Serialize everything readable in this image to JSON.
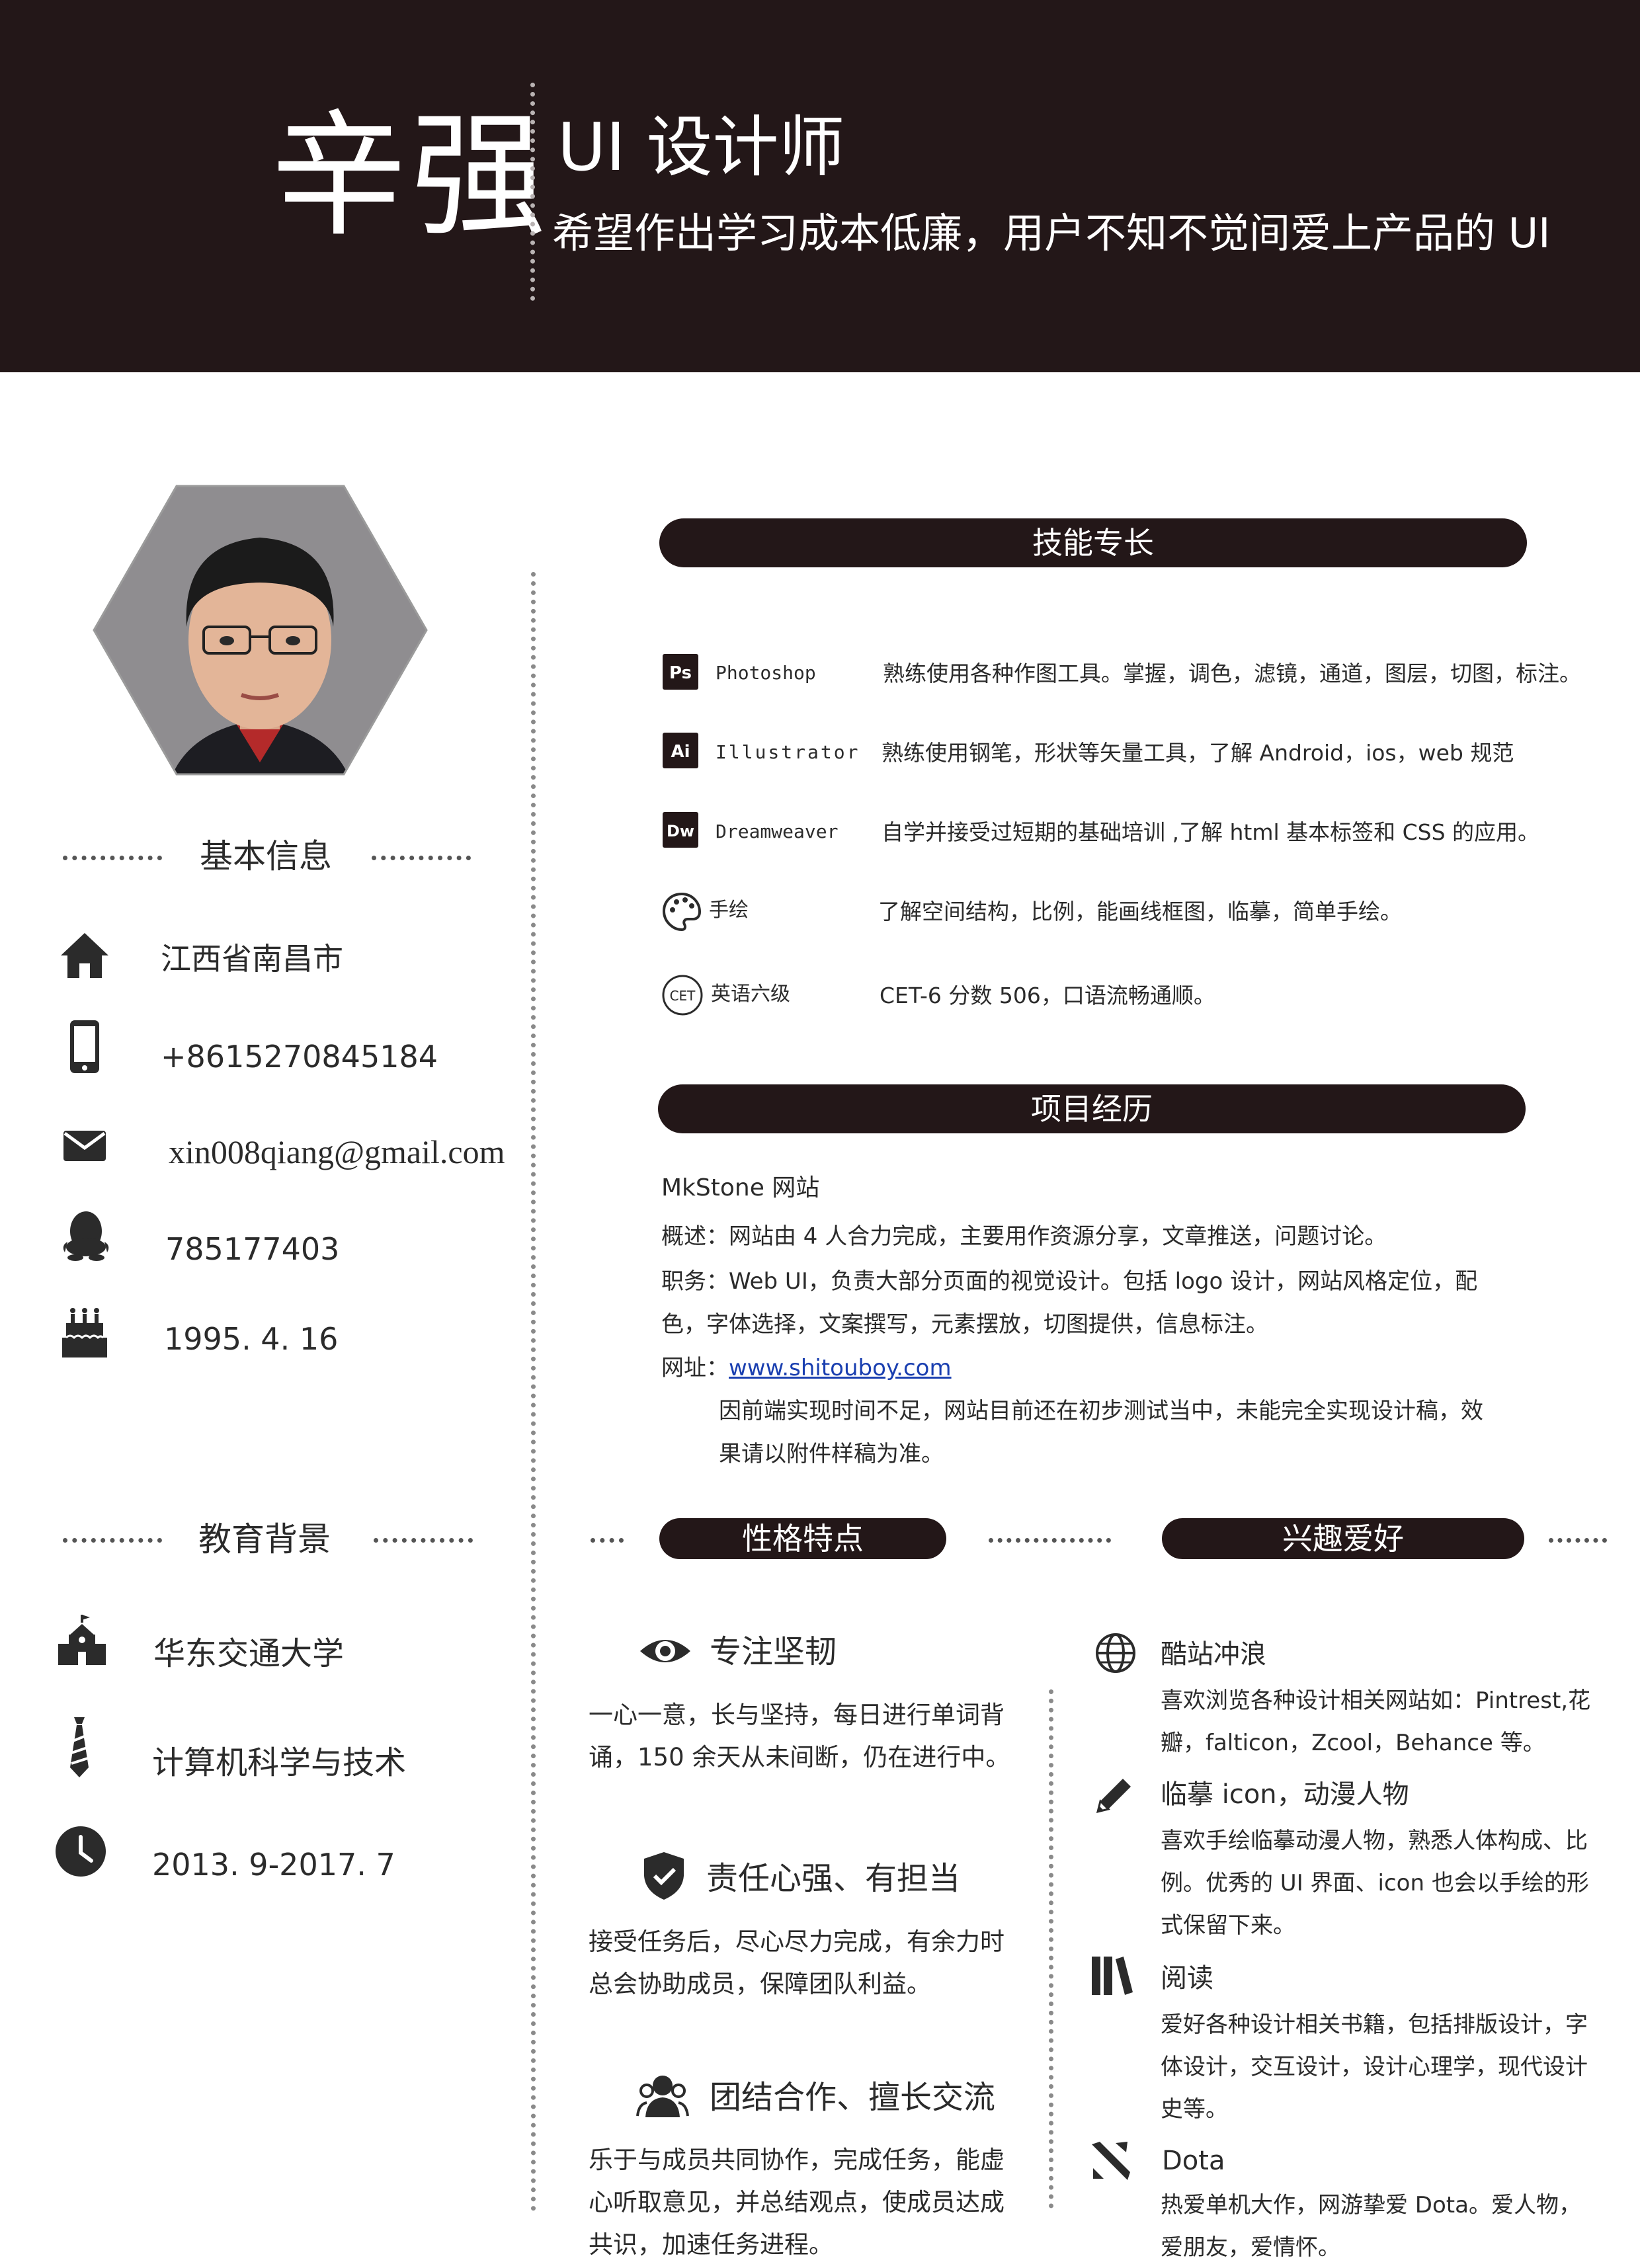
{
  "header": {
    "name": "辛强",
    "title": "UI 设计师",
    "slogan": "希望作出学习成本低廉，用户不知不觉间爱上产品的 UI"
  },
  "basic_info": {
    "section_title": "基本信息",
    "items": [
      {
        "icon": "home-icon",
        "text": "江西省南昌市"
      },
      {
        "icon": "phone-icon",
        "text": "+8615270845184"
      },
      {
        "icon": "mail-icon",
        "text": "xin008qiang@gmail.com"
      },
      {
        "icon": "qq-icon",
        "text": "785177403"
      },
      {
        "icon": "birthday-cake-icon",
        "text": "1995. 4. 16"
      }
    ]
  },
  "education": {
    "section_title": "教育背景",
    "items": [
      {
        "icon": "school-icon",
        "text": "华东交通大学"
      },
      {
        "icon": "tie-icon",
        "text": "计算机科学与技术"
      },
      {
        "icon": "clock-icon",
        "text": "2013. 9-2017. 7"
      }
    ]
  },
  "skills": {
    "section_title": "技能专长",
    "items": [
      {
        "icon": "photoshop-icon",
        "icon_text": "Ps",
        "name": "Photoshop",
        "desc": "熟练使用各种作图工具。掌握，调色，滤镜，通道，图层，切图，标注。"
      },
      {
        "icon": "illustrator-icon",
        "icon_text": "Ai",
        "name": "Illustrator",
        "desc": "熟练使用钢笔，形状等矢量工具，了解 Android，ios，web 规范"
      },
      {
        "icon": "dreamweaver-icon",
        "icon_text": "Dw",
        "name": "Dreamweaver",
        "desc": "自学并接受过短期的基础培训 ,了解 html 基本标签和 CSS 的应用。"
      },
      {
        "icon": "palette-icon",
        "name": "手绘",
        "desc": "了解空间结构，比例，能画线框图，临摹，简单手绘。"
      },
      {
        "icon": "cet-icon",
        "icon_text": "CET",
        "name": "英语六级",
        "desc": "CET-6 分数 506，口语流畅通顺。"
      }
    ]
  },
  "projects": {
    "section_title": "项目经历",
    "name": "MkStone 网站",
    "overview": "概述：网站由 4 人合力完成，主要用作资源分享，文章推送，问题讨论。",
    "role_line1": "职务：Web UI，负责大部分页面的视觉设计。包括 logo 设计，网站风格定位，配",
    "role_line2": "色，字体选择，文案撰写，元素摆放，切图提供，信息标注。",
    "url_label": "网址：",
    "url": "www.shitouboy.com",
    "note_line1": "因前端实现时间不足，网站目前还在初步测试当中，未能完全实现设计稿，效",
    "note_line2": "果请以附件样稿为准。"
  },
  "personality": {
    "section_title": "性格特点",
    "items": [
      {
        "icon": "eye-icon",
        "title": "专注坚韧",
        "desc": "一心一意，长与坚持，每日进行单词背诵，150 余天从未间断，仍在进行中。"
      },
      {
        "icon": "shield-check-icon",
        "title": "责任心强、有担当",
        "desc": "接受任务后，尽心尽力完成，有余力时总会协助成员，保障团队利益。"
      },
      {
        "icon": "team-icon",
        "title": "团结合作、擅长交流",
        "desc": "乐于与成员共同协作，完成任务，能虚心听取意见，并总结观点，使成员达成共识，加速任务进程。"
      }
    ]
  },
  "hobbies": {
    "section_title": "兴趣爱好",
    "items": [
      {
        "icon": "globe-icon",
        "title": "酷站冲浪",
        "desc": "喜欢浏览各种设计相关网站如：Pintrest,花瓣，falticon，Zcool，Behance 等。"
      },
      {
        "icon": "pencil-icon",
        "title": "临摹 icon，动漫人物",
        "desc": "喜欢手绘临摹动漫人物，熟悉人体构成、比例。优秀的 UI 界面、icon 也会以手绘的形式保留下来。"
      },
      {
        "icon": "books-icon",
        "title": "阅读",
        "desc": "爱好各种设计相关书籍，包括排版设计，字体设计，交互设计，设计心理学，现代设计史等。"
      },
      {
        "icon": "dota-icon",
        "title": "Dota",
        "desc": "热爱单机大作，网游挚爱 Dota。爱人物，爱朋友，爱情怀。"
      }
    ]
  }
}
